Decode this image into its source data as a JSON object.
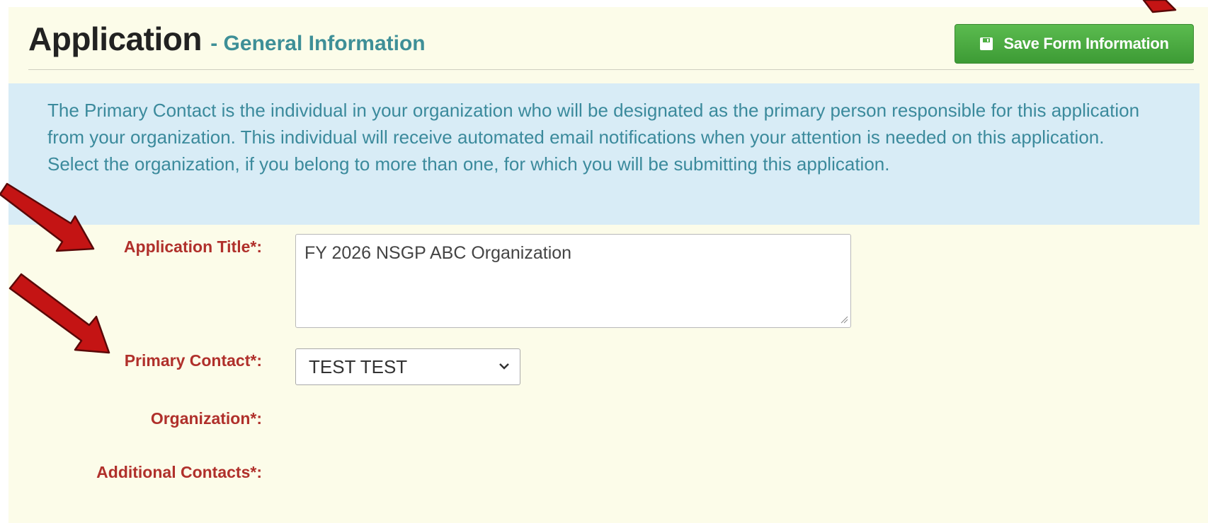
{
  "header": {
    "title": "Application",
    "subtitle": "- General Information",
    "save_label": "Save Form Information",
    "save_icon": "floppy-disk-icon"
  },
  "info": {
    "line1": "The Primary Contact is the individual in your organization who will be designated as the primary person responsible for this application from your organization. This individual will receive automated email notifications when your attention is needed on this application.",
    "line2": "Select the organization, if you belong to more than one, for which you will be submitting this application."
  },
  "form": {
    "application_title_label": "Application Title*:",
    "application_title_value": "FY 2026 NSGP ABC Organization",
    "primary_contact_label": "Primary Contact*:",
    "primary_contact_value": "TEST TEST",
    "organization_label": "Organization*:",
    "additional_contacts_label": "Additional Contacts*:"
  },
  "colors": {
    "panel_bg": "#fcfce9",
    "info_bg": "#d8ecf6",
    "info_text": "#3b8a9c",
    "label_red": "#b0302b",
    "subtitle_teal": "#3e8f97",
    "save_green": "#4cae41",
    "annotation_arrow": "#c41414"
  }
}
